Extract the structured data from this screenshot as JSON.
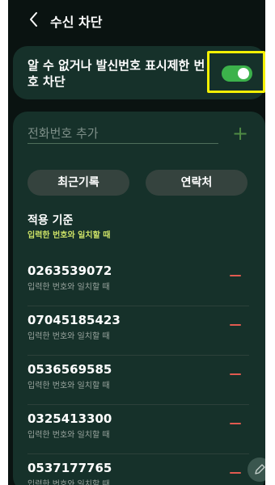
{
  "header": {
    "title": "수신 차단"
  },
  "block_unknown": {
    "label": "알 수 없거나 발신번호 표시제한 번호 차단",
    "toggle_on": true,
    "highlight_color": "#f4f004"
  },
  "phone_input": {
    "placeholder": "전화번호 추가"
  },
  "buttons": {
    "recent": "최근기록",
    "contacts": "연락처"
  },
  "criteria": {
    "title": "적용 기준",
    "subtitle": "입력한 번호와 일치할 때"
  },
  "entries": [
    {
      "number": "0263539072",
      "desc": "입력한 번호와 일치할 때"
    },
    {
      "number": "07045185423",
      "desc": "입력한 번호와 일치할 때"
    },
    {
      "number": "0536569585",
      "desc": "입력한 번호와 일치할 때"
    },
    {
      "number": "0325413300",
      "desc": "입력한 번호와 일치할 때"
    },
    {
      "number": "0537177765",
      "desc": "입력한 번호와 일치할 때"
    }
  ],
  "colors": {
    "background": "#0a1311",
    "card": "#16312a",
    "toggle_accent": "#3cb24b",
    "criteria_accent": "#cbe066",
    "remove_accent": "#e15a50"
  },
  "icons": {
    "back": "chevron-left-icon",
    "add": "plus-icon",
    "remove": "minus-icon",
    "edit": "pencil-icon"
  }
}
